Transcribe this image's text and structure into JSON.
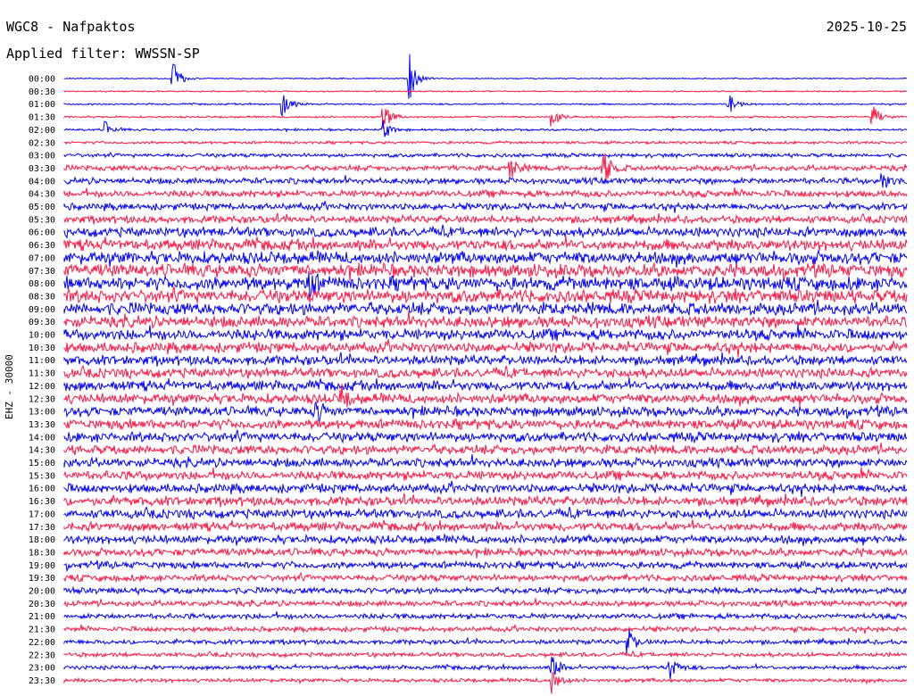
{
  "header": {
    "station": "WGC8 - Nafpaktos",
    "filter": "Applied filter: WWSSN-SP",
    "date": "2025-10-25",
    "channel": "EHZ - 30000"
  },
  "colors": {
    "trace_a": "#0000ff",
    "trace_b": "#ff1744",
    "background": "#ffffff"
  },
  "chart_data": {
    "type": "line",
    "title": "WGC8 - Nafpaktos",
    "subtitle": "Applied filter: WWSSN-SP",
    "ylabel": "EHZ - 30000",
    "xlabel": "",
    "row_interval_minutes": 30,
    "row_labels": [
      "00:00",
      "00:30",
      "01:00",
      "01:30",
      "02:00",
      "02:30",
      "03:00",
      "03:30",
      "04:00",
      "04:30",
      "05:00",
      "05:30",
      "06:00",
      "06:30",
      "07:00",
      "07:30",
      "08:00",
      "08:30",
      "09:00",
      "09:30",
      "10:00",
      "10:30",
      "11:00",
      "11:30",
      "12:00",
      "12:30",
      "13:00",
      "13:30",
      "14:00",
      "14:30",
      "15:00",
      "15:30",
      "16:00",
      "16:30",
      "17:00",
      "17:30",
      "18:00",
      "18:30",
      "19:00",
      "19:30",
      "20:00",
      "20:30",
      "21:00",
      "21:30",
      "22:00",
      "22:30",
      "23:00",
      "23:30"
    ],
    "trace_colors": [
      "#0000ff",
      "#ff1744"
    ],
    "noise_level": [
      0.08,
      0.1,
      0.12,
      0.14,
      0.16,
      0.2,
      0.28,
      0.4,
      0.45,
      0.5,
      0.5,
      0.55,
      0.7,
      0.8,
      0.9,
      0.95,
      1.0,
      0.95,
      0.9,
      0.85,
      0.8,
      0.75,
      0.7,
      0.7,
      0.72,
      0.72,
      0.7,
      0.72,
      0.7,
      0.68,
      0.66,
      0.65,
      0.66,
      0.68,
      0.66,
      0.64,
      0.6,
      0.56,
      0.52,
      0.48,
      0.45,
      0.42,
      0.4,
      0.36,
      0.34,
      0.32,
      0.3,
      0.28
    ],
    "events": [
      {
        "row": 0,
        "x_fraction": 0.13,
        "amplitude": 2.2
      },
      {
        "row": 0,
        "x_fraction": 0.41,
        "amplitude": 3.0
      },
      {
        "row": 2,
        "x_fraction": 0.26,
        "amplitude": 1.8
      },
      {
        "row": 3,
        "x_fraction": 0.38,
        "amplitude": 1.6
      },
      {
        "row": 4,
        "x_fraction": 0.05,
        "amplitude": 1.0
      },
      {
        "row": 4,
        "x_fraction": 0.38,
        "amplitude": 1.2
      },
      {
        "row": 7,
        "x_fraction": 0.64,
        "amplitude": 2.4
      },
      {
        "row": 7,
        "x_fraction": 0.53,
        "amplitude": 1.4
      },
      {
        "row": 3,
        "x_fraction": 0.58,
        "amplitude": 1.2
      },
      {
        "row": 2,
        "x_fraction": 0.79,
        "amplitude": 1.4
      },
      {
        "row": 3,
        "x_fraction": 0.96,
        "amplitude": 1.4
      },
      {
        "row": 8,
        "x_fraction": 0.97,
        "amplitude": 1.3
      },
      {
        "row": 16,
        "x_fraction": 0.29,
        "amplitude": 1.6
      },
      {
        "row": 25,
        "x_fraction": 0.33,
        "amplitude": 1.4
      },
      {
        "row": 26,
        "x_fraction": 0.3,
        "amplitude": 1.2
      },
      {
        "row": 44,
        "x_fraction": 0.67,
        "amplitude": 1.6
      },
      {
        "row": 46,
        "x_fraction": 0.58,
        "amplitude": 1.3
      },
      {
        "row": 47,
        "x_fraction": 0.58,
        "amplitude": 1.5
      },
      {
        "row": 46,
        "x_fraction": 0.72,
        "amplitude": 1.4
      }
    ]
  }
}
